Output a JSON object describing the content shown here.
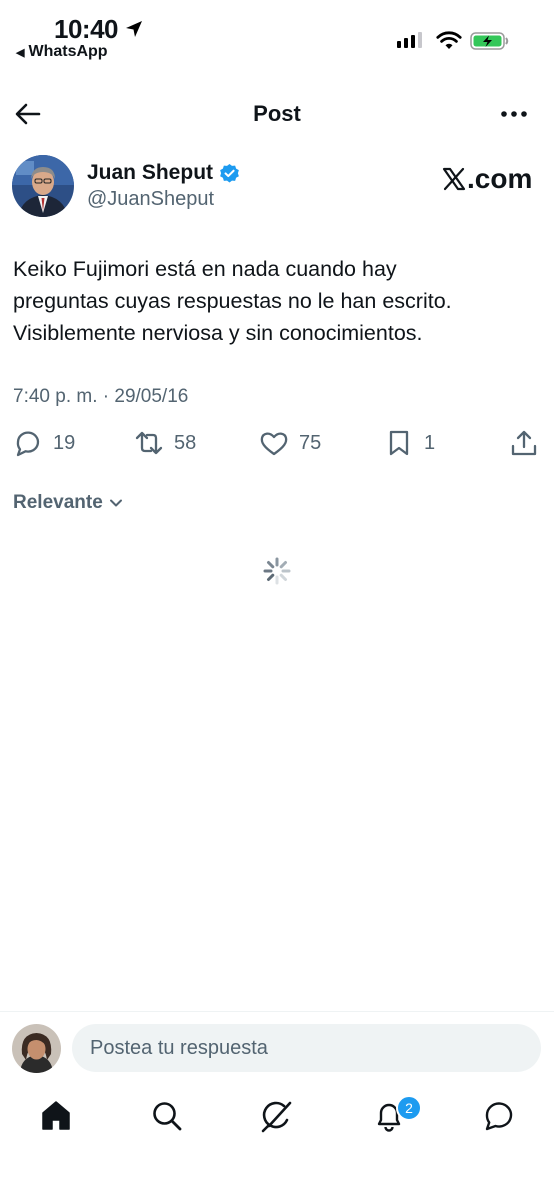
{
  "status_bar": {
    "time": "10:40",
    "back_app": "WhatsApp",
    "back_glyph": "◀",
    "icons": [
      "location-arrow-icon",
      "cellular-signal-icon",
      "wifi-icon",
      "battery-charging-icon"
    ]
  },
  "header": {
    "title": "Post",
    "icons": [
      "back-arrow-icon",
      "more-icon"
    ]
  },
  "post": {
    "author_name": "Juan Sheput",
    "author_handle": "@JuanSheput",
    "verified": true,
    "source_logo": "com",
    "text_lines": [
      "Keiko Fujimori está en nada cuando hay",
      "preguntas cuyas respuestas no le han escrito.",
      "Visiblemente nerviosa y sin conocimientos."
    ],
    "timestamp": "7:40 p. m. · 29/05/16",
    "stats": {
      "replies": "19",
      "reposts": "58",
      "likes": "75",
      "bookmarks": "1"
    }
  },
  "replies_filter": {
    "label": "Relevante"
  },
  "reply_bar": {
    "placeholder": "Postea tu respuesta"
  },
  "tab_bar": {
    "items": [
      "home-icon",
      "search-icon",
      "grok-icon",
      "notifications-icon",
      "messages-icon"
    ],
    "notifications_count": "2"
  },
  "colors": {
    "accent": "#1d9bf0",
    "text": "#0f1419",
    "muted": "#536471",
    "battery_green": "#34c759"
  }
}
